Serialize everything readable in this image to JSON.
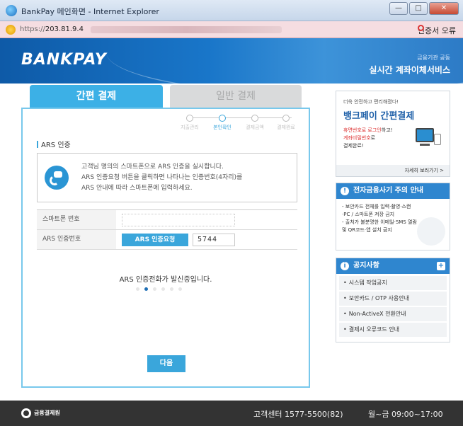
{
  "window": {
    "title": "BankPay 메인화면 - Internet Explorer",
    "controls": {
      "minimize": "—",
      "maximize": "□",
      "close": "✕"
    }
  },
  "address_bar": {
    "url_prefix": "https://",
    "url_host": "203.81.9.4",
    "cert_label": "인증서 오류"
  },
  "header": {
    "logo": "BANKPAY",
    "org": "금융기관 공동",
    "service": "실시간 계좌이체서비스"
  },
  "tabs": [
    {
      "label": "간편 결제",
      "active": true
    },
    {
      "label": "일반 결제",
      "active": false
    }
  ],
  "steps": [
    {
      "label": "지출관리",
      "current": false
    },
    {
      "label": "본인확인",
      "current": true
    },
    {
      "label": "결제금액",
      "current": false
    },
    {
      "label": "결제완료",
      "current": false
    }
  ],
  "auth": {
    "section_title": "ARS 인증",
    "info_lines": [
      "고객님 명의의 스마트폰으로 ARS 인증을 실시합니다.",
      "ARS 인증요청 버튼을 클릭하면 나타나는 인증번호(4자리)를",
      "ARS 안내에 따라 스마트폰에 입력하세요."
    ],
    "phone_label": "스마트폰 번호",
    "phone_value": "",
    "ars_label": "ARS 인증번호",
    "ars_button": "ARS 인증요청",
    "ars_code": "5744",
    "calling_message": "ARS 인증전화가 발신중입니다.",
    "dots_total": 6,
    "dots_active": 1,
    "next_button": "다음"
  },
  "sidebar": {
    "promo": {
      "small": "더욱 안전하고 편리해졌다!",
      "title": "뱅크페이 간편결제",
      "line1_red": "휴면번호로 로그인",
      "line1_rest": "하고!",
      "line2_red": "계좌비밀번호",
      "line2_rest": "로",
      "line3": "결제완료!",
      "more": "자세히 보러가기 >"
    },
    "fraud": {
      "title": "전자금융사기 주의 안내",
      "lines": [
        "- 보안카드 전체를 입력·촬영·스캔",
        "  ·PC / 스마트폰 저장 금지",
        "- 출처가 불분명한 이메일·SMS 열람",
        "  및 QR코드·앱 설치 금지"
      ]
    },
    "notice": {
      "title": "공지사항",
      "items": [
        "시스템 작업공지",
        "보안카드 / OTP 사용안내",
        "Non-ActiveX 전환안내",
        "결제시 오류코드 안내"
      ]
    }
  },
  "footer": {
    "logo": "금융결제원",
    "customer_center": "고객센터 1577-5500(82)",
    "hours": "월~금 09:00~17:00"
  },
  "colors": {
    "accent": "#3aa6db",
    "header_blue": "#1976c9",
    "footer": "#333333",
    "warning": "#dd3333"
  }
}
